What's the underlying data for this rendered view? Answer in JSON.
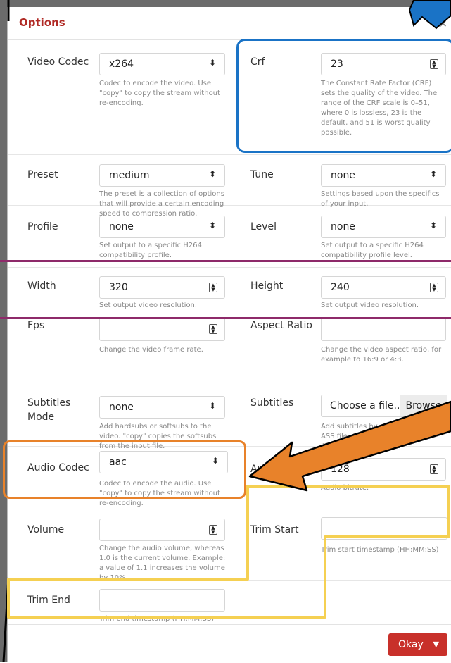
{
  "dialog": {
    "title": "Options",
    "close_glyph": "×"
  },
  "fields": {
    "video_codec": {
      "label": "Video Codec",
      "value": "x264",
      "help": "Codec to encode the video. Use \"copy\" to copy the stream without re-encoding."
    },
    "crf": {
      "label": "Crf",
      "value": "23",
      "help": "The Constant Rate Factor (CRF) sets the quality of the video. The range of the CRF scale is 0–51, where 0 is lossless, 23 is the default, and 51 is worst quality possible."
    },
    "preset": {
      "label": "Preset",
      "value": "medium",
      "help": "The preset is a collection of options that will provide a certain encoding speed to compression ratio."
    },
    "tune": {
      "label": "Tune",
      "value": "none",
      "help": "Settings based upon the specifics of your input."
    },
    "profile": {
      "label": "Profile",
      "value": "none",
      "help": "Set output to a specific H264 compatibility profile."
    },
    "level": {
      "label": "Level",
      "value": "none",
      "help": "Set output to a specific H264 compatibility profile level."
    },
    "width": {
      "label": "Width",
      "value": "320",
      "help": "Set output video resolution."
    },
    "height": {
      "label": "Height",
      "value": "240",
      "help": "Set output video resolution."
    },
    "fps": {
      "label": "Fps",
      "value": "",
      "help": "Change the video frame rate."
    },
    "aspect_ratio": {
      "label": "Aspect Ratio",
      "value": "",
      "help": "Change the video aspect ratio, for example to 16:9 or 4:3."
    },
    "subtitles_mode": {
      "label": "Subtitles Mode",
      "value": "none",
      "help": "Add hardsubs or softsubs to the video. \"copy\" copies the softsubs from the input file."
    },
    "subtitles": {
      "label": "Subtitles",
      "value": "Choose a file...",
      "browse": "Browse",
      "help": "Add subtitles by selecting a SRT or ASS file. Only has an effect, if \"Subtitles Mode\" is set"
    },
    "audio_codec": {
      "label": "Audio Codec",
      "value": "aac",
      "help": "Codec to encode the audio. Use \"copy\" to copy the stream without re-encoding."
    },
    "audio_bitrate": {
      "label": "Au",
      "value": "128",
      "help": "Audio bitrate."
    },
    "volume": {
      "label": "Volume",
      "value": "",
      "help": "Change the audio volume, whereas 1.0 is the current volume. Example: a value of 1.1 increases the volume by 10%."
    },
    "trim_start": {
      "label": "Trim Start",
      "value": "",
      "help": "Trim start timestamp (HH:MM:SS)"
    },
    "trim_end": {
      "label": "Trim End",
      "value": "",
      "help": "Trim end timestamp (HH:MM:SS)"
    }
  },
  "footer": {
    "okay_label": "Okay"
  },
  "annotation_colors": {
    "blue": "#1a73c6",
    "orange": "#e8822a",
    "yellow": "#f5d052",
    "purple": "#8e2a6a",
    "accent": "#c8302a"
  }
}
